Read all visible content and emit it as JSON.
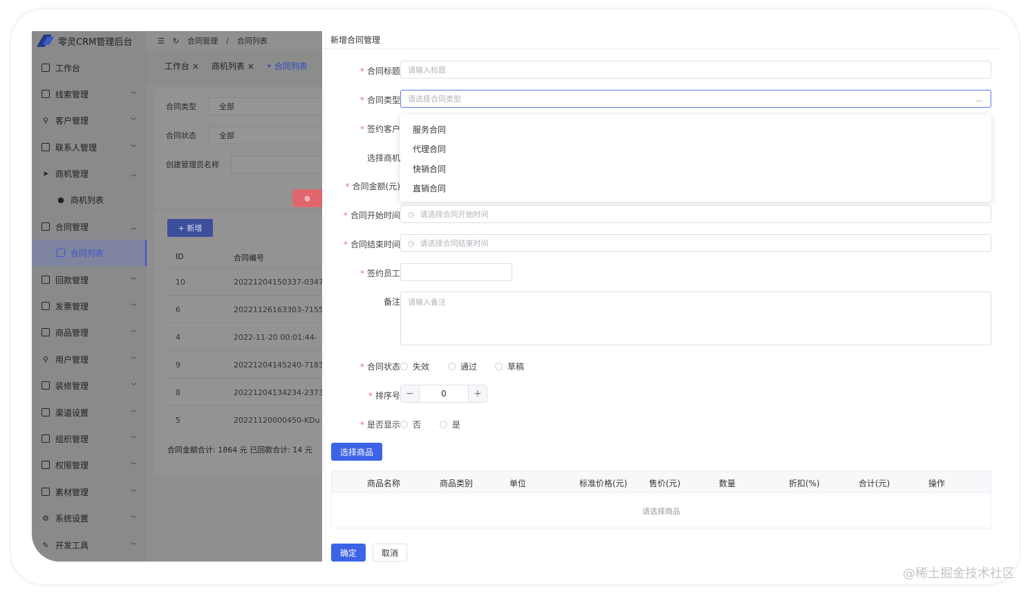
{
  "app": {
    "title": "零灵CRM管理后台"
  },
  "sidebar": {
    "items": [
      {
        "label": "工作台",
        "icon": "monitor-icon"
      },
      {
        "label": "线索管理",
        "icon": "clue-icon"
      },
      {
        "label": "客户管理",
        "icon": "user-icon"
      },
      {
        "label": "联系人管理",
        "icon": "contact-icon"
      },
      {
        "label": "商机管理",
        "icon": "send-icon"
      },
      {
        "label": "商机列表",
        "icon": "bulb-icon"
      },
      {
        "label": "合同管理",
        "icon": "briefcase-icon"
      },
      {
        "label": "合同列表",
        "icon": "document-icon"
      },
      {
        "label": "回款管理",
        "icon": "payment-icon"
      },
      {
        "label": "发票管理",
        "icon": "invoice-icon"
      },
      {
        "label": "商品管理",
        "icon": "bag-icon"
      },
      {
        "label": "用户管理",
        "icon": "user-icon"
      },
      {
        "label": "装修管理",
        "icon": "decorate-icon"
      },
      {
        "label": "渠道设置",
        "icon": "mail-icon"
      },
      {
        "label": "组织管理",
        "icon": "org-icon"
      },
      {
        "label": "权限管理",
        "icon": "lock-icon"
      },
      {
        "label": "素材管理",
        "icon": "image-icon"
      },
      {
        "label": "系统设置",
        "icon": "gear-icon"
      },
      {
        "label": "开发工具",
        "icon": "pen-icon"
      }
    ]
  },
  "topbar": {
    "crumb1": "合同管理",
    "sep": "/",
    "crumb2": "合同列表"
  },
  "tabs": [
    {
      "label": "工作台"
    },
    {
      "label": "商机列表"
    },
    {
      "label": "合同列表"
    }
  ],
  "filters": {
    "type_label": "合同类型",
    "type_value": "全部",
    "status_label": "合同状态",
    "status_value": "全部",
    "creator_label": "创建管理员名称"
  },
  "list": {
    "add_label": "+ 新增",
    "columns": [
      "ID",
      "合同编号"
    ],
    "rows": [
      {
        "id": "10",
        "code": "20221204150337-0347"
      },
      {
        "id": "6",
        "code": "20221126163303-7155"
      },
      {
        "id": "4",
        "code": "2022-11-20 00:01:44-"
      },
      {
        "id": "9",
        "code": "20221204145240-7183"
      },
      {
        "id": "8",
        "code": "20221204134234-2373"
      },
      {
        "id": "5",
        "code": "20221120000450-KDu"
      }
    ],
    "summary": "合同金额合计: 1864 元   已回款合计: 14 元"
  },
  "drawer": {
    "title": "新增合同管理",
    "fields": {
      "title_label": "合同标题",
      "title_placeholder": "请输入标题",
      "type_label": "合同类型",
      "type_placeholder": "请选择合同类型",
      "customer_label": "签约客户",
      "opportunity_label": "选择商机",
      "amount_label": "合同金额(元)",
      "start_label": "合同开始时间",
      "start_placeholder": "请选择合同开始时间",
      "end_label": "合同结束时间",
      "end_placeholder": "请选择合同结束时间",
      "staff_label": "签约员工",
      "remark_label": "备注",
      "remark_placeholder": "请输入备注",
      "status_label": "合同状态",
      "sort_label": "排序号",
      "sort_value": "0",
      "show_label": "是否显示"
    },
    "type_options": [
      "服务合同",
      "代理合同",
      "快销合同",
      "直销合同"
    ],
    "status_options": [
      "失效",
      "通过",
      "草稿"
    ],
    "show_options": [
      "否",
      "是"
    ],
    "select_goods": "选择商品",
    "goods_columns": [
      "商品名称",
      "商品类别",
      "单位",
      "标准价格(元)",
      "售价(元)",
      "数量",
      "折扣(%)",
      "合计(元)",
      "操作"
    ],
    "goods_empty": "请选择商品",
    "confirm": "确定",
    "cancel": "取消"
  },
  "watermark": "@稀土掘金技术社区",
  "colors": {
    "primary": "#3d63e6",
    "required": "#f56c6c",
    "danger": "#e0666d"
  }
}
